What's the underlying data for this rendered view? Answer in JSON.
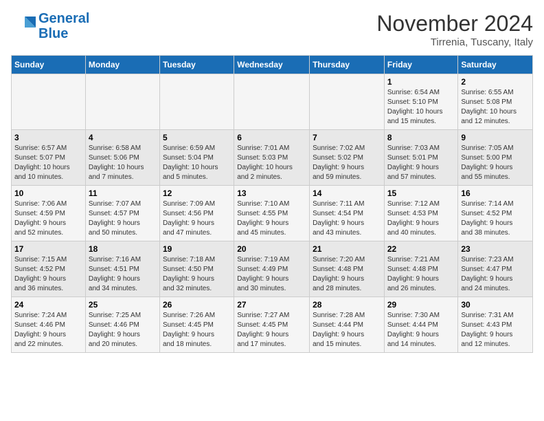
{
  "logo": {
    "line1": "General",
    "line2": "Blue"
  },
  "title": "November 2024",
  "subtitle": "Tirrenia, Tuscany, Italy",
  "days_header": [
    "Sunday",
    "Monday",
    "Tuesday",
    "Wednesday",
    "Thursday",
    "Friday",
    "Saturday"
  ],
  "weeks": [
    [
      {
        "day": "",
        "info": ""
      },
      {
        "day": "",
        "info": ""
      },
      {
        "day": "",
        "info": ""
      },
      {
        "day": "",
        "info": ""
      },
      {
        "day": "",
        "info": ""
      },
      {
        "day": "1",
        "info": "Sunrise: 6:54 AM\nSunset: 5:10 PM\nDaylight: 10 hours\nand 15 minutes."
      },
      {
        "day": "2",
        "info": "Sunrise: 6:55 AM\nSunset: 5:08 PM\nDaylight: 10 hours\nand 12 minutes."
      }
    ],
    [
      {
        "day": "3",
        "info": "Sunrise: 6:57 AM\nSunset: 5:07 PM\nDaylight: 10 hours\nand 10 minutes."
      },
      {
        "day": "4",
        "info": "Sunrise: 6:58 AM\nSunset: 5:06 PM\nDaylight: 10 hours\nand 7 minutes."
      },
      {
        "day": "5",
        "info": "Sunrise: 6:59 AM\nSunset: 5:04 PM\nDaylight: 10 hours\nand 5 minutes."
      },
      {
        "day": "6",
        "info": "Sunrise: 7:01 AM\nSunset: 5:03 PM\nDaylight: 10 hours\nand 2 minutes."
      },
      {
        "day": "7",
        "info": "Sunrise: 7:02 AM\nSunset: 5:02 PM\nDaylight: 9 hours\nand 59 minutes."
      },
      {
        "day": "8",
        "info": "Sunrise: 7:03 AM\nSunset: 5:01 PM\nDaylight: 9 hours\nand 57 minutes."
      },
      {
        "day": "9",
        "info": "Sunrise: 7:05 AM\nSunset: 5:00 PM\nDaylight: 9 hours\nand 55 minutes."
      }
    ],
    [
      {
        "day": "10",
        "info": "Sunrise: 7:06 AM\nSunset: 4:59 PM\nDaylight: 9 hours\nand 52 minutes."
      },
      {
        "day": "11",
        "info": "Sunrise: 7:07 AM\nSunset: 4:57 PM\nDaylight: 9 hours\nand 50 minutes."
      },
      {
        "day": "12",
        "info": "Sunrise: 7:09 AM\nSunset: 4:56 PM\nDaylight: 9 hours\nand 47 minutes."
      },
      {
        "day": "13",
        "info": "Sunrise: 7:10 AM\nSunset: 4:55 PM\nDaylight: 9 hours\nand 45 minutes."
      },
      {
        "day": "14",
        "info": "Sunrise: 7:11 AM\nSunset: 4:54 PM\nDaylight: 9 hours\nand 43 minutes."
      },
      {
        "day": "15",
        "info": "Sunrise: 7:12 AM\nSunset: 4:53 PM\nDaylight: 9 hours\nand 40 minutes."
      },
      {
        "day": "16",
        "info": "Sunrise: 7:14 AM\nSunset: 4:52 PM\nDaylight: 9 hours\nand 38 minutes."
      }
    ],
    [
      {
        "day": "17",
        "info": "Sunrise: 7:15 AM\nSunset: 4:52 PM\nDaylight: 9 hours\nand 36 minutes."
      },
      {
        "day": "18",
        "info": "Sunrise: 7:16 AM\nSunset: 4:51 PM\nDaylight: 9 hours\nand 34 minutes."
      },
      {
        "day": "19",
        "info": "Sunrise: 7:18 AM\nSunset: 4:50 PM\nDaylight: 9 hours\nand 32 minutes."
      },
      {
        "day": "20",
        "info": "Sunrise: 7:19 AM\nSunset: 4:49 PM\nDaylight: 9 hours\nand 30 minutes."
      },
      {
        "day": "21",
        "info": "Sunrise: 7:20 AM\nSunset: 4:48 PM\nDaylight: 9 hours\nand 28 minutes."
      },
      {
        "day": "22",
        "info": "Sunrise: 7:21 AM\nSunset: 4:48 PM\nDaylight: 9 hours\nand 26 minutes."
      },
      {
        "day": "23",
        "info": "Sunrise: 7:23 AM\nSunset: 4:47 PM\nDaylight: 9 hours\nand 24 minutes."
      }
    ],
    [
      {
        "day": "24",
        "info": "Sunrise: 7:24 AM\nSunset: 4:46 PM\nDaylight: 9 hours\nand 22 minutes."
      },
      {
        "day": "25",
        "info": "Sunrise: 7:25 AM\nSunset: 4:46 PM\nDaylight: 9 hours\nand 20 minutes."
      },
      {
        "day": "26",
        "info": "Sunrise: 7:26 AM\nSunset: 4:45 PM\nDaylight: 9 hours\nand 18 minutes."
      },
      {
        "day": "27",
        "info": "Sunrise: 7:27 AM\nSunset: 4:45 PM\nDaylight: 9 hours\nand 17 minutes."
      },
      {
        "day": "28",
        "info": "Sunrise: 7:28 AM\nSunset: 4:44 PM\nDaylight: 9 hours\nand 15 minutes."
      },
      {
        "day": "29",
        "info": "Sunrise: 7:30 AM\nSunset: 4:44 PM\nDaylight: 9 hours\nand 14 minutes."
      },
      {
        "day": "30",
        "info": "Sunrise: 7:31 AM\nSunset: 4:43 PM\nDaylight: 9 hours\nand 12 minutes."
      }
    ]
  ]
}
